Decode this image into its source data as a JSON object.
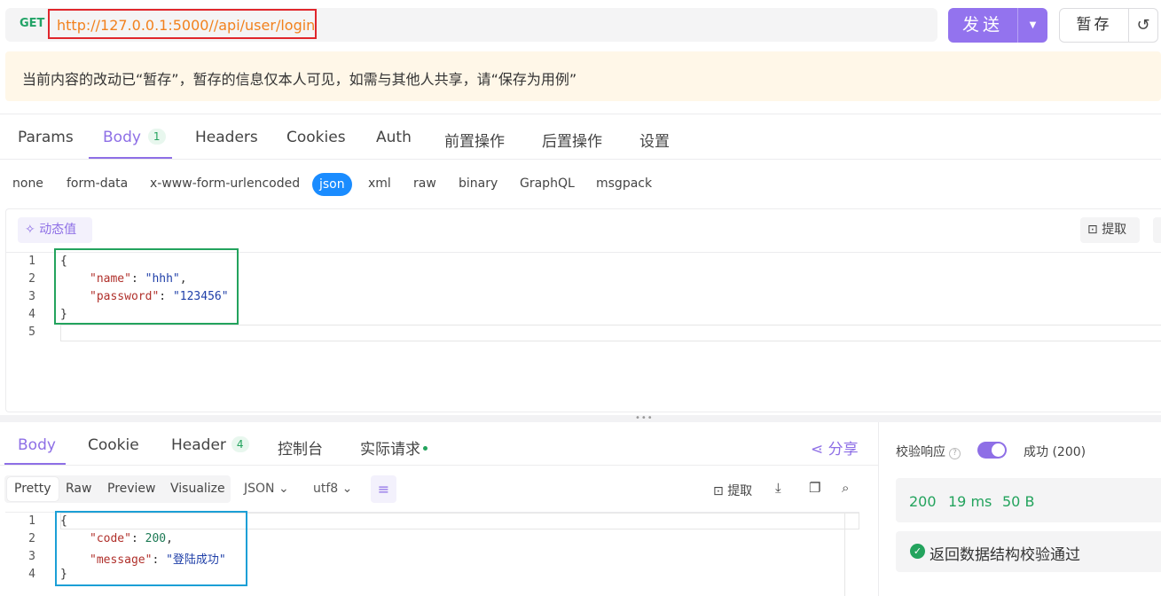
{
  "request": {
    "method": "GET",
    "url": "http://127.0.0.1:5000//api/user/login",
    "send_label": "发送",
    "save_label": "暂存"
  },
  "notice": "当前内容的改动已“暂存”，暂存的信息仅本人可见，如需与其他人共享，请“保存为用例”",
  "request_tabs": [
    {
      "label": "Params"
    },
    {
      "label": "Body",
      "badge": "1"
    },
    {
      "label": "Headers"
    },
    {
      "label": "Cookies"
    },
    {
      "label": "Auth"
    },
    {
      "label": "前置操作"
    },
    {
      "label": "后置操作"
    },
    {
      "label": "设置"
    }
  ],
  "body_types": [
    "none",
    "form-data",
    "x-www-form-urlencoded",
    "json",
    "xml",
    "raw",
    "binary",
    "GraphQL",
    "msgpack"
  ],
  "editor": {
    "dynamic_value_label": "动态值",
    "extract_label": "提取",
    "line_numbers": [
      "1",
      "2",
      "3",
      "4",
      "5"
    ],
    "lines": [
      {
        "text": "{"
      },
      {
        "key": "\"name\"",
        "value": "\"hhh\"",
        "trail": ","
      },
      {
        "key": "\"password\"",
        "value": "\"123456\"",
        "trail": ""
      },
      {
        "text": "}"
      },
      {
        "text": ""
      }
    ]
  },
  "response": {
    "tabs": [
      {
        "label": "Body"
      },
      {
        "label": "Cookie"
      },
      {
        "label": "Header",
        "badge": "4"
      },
      {
        "label": "控制台"
      },
      {
        "label": "实际请求"
      }
    ],
    "share_label": "分享",
    "view_modes": [
      "Pretty",
      "Raw",
      "Preview",
      "Visualize"
    ],
    "format": "JSON",
    "encoding": "utf8",
    "extract_label": "提取",
    "line_numbers": [
      "1",
      "2",
      "3",
      "4"
    ],
    "lines": [
      {
        "text": "{"
      },
      {
        "key": "\"code\"",
        "value": "200",
        "trail": ","
      },
      {
        "key": "\"message\"",
        "value": "\"登陆成功\"",
        "trail": ""
      },
      {
        "text": "}"
      }
    ]
  },
  "validation": {
    "label": "校验响应",
    "enabled": true,
    "result": "成功 (200)",
    "status_code": "200",
    "time": "19 ms",
    "size": "50 B",
    "message": "返回数据结构校验通过"
  },
  "colors": {
    "accent": "#8e6fe6",
    "success": "#23a35d",
    "url_text": "#f2811d",
    "json_button": "#1a8cff",
    "highlight_red": "#e0262c",
    "highlight_green": "#23a35d",
    "highlight_blue": "#1c9fd6"
  }
}
